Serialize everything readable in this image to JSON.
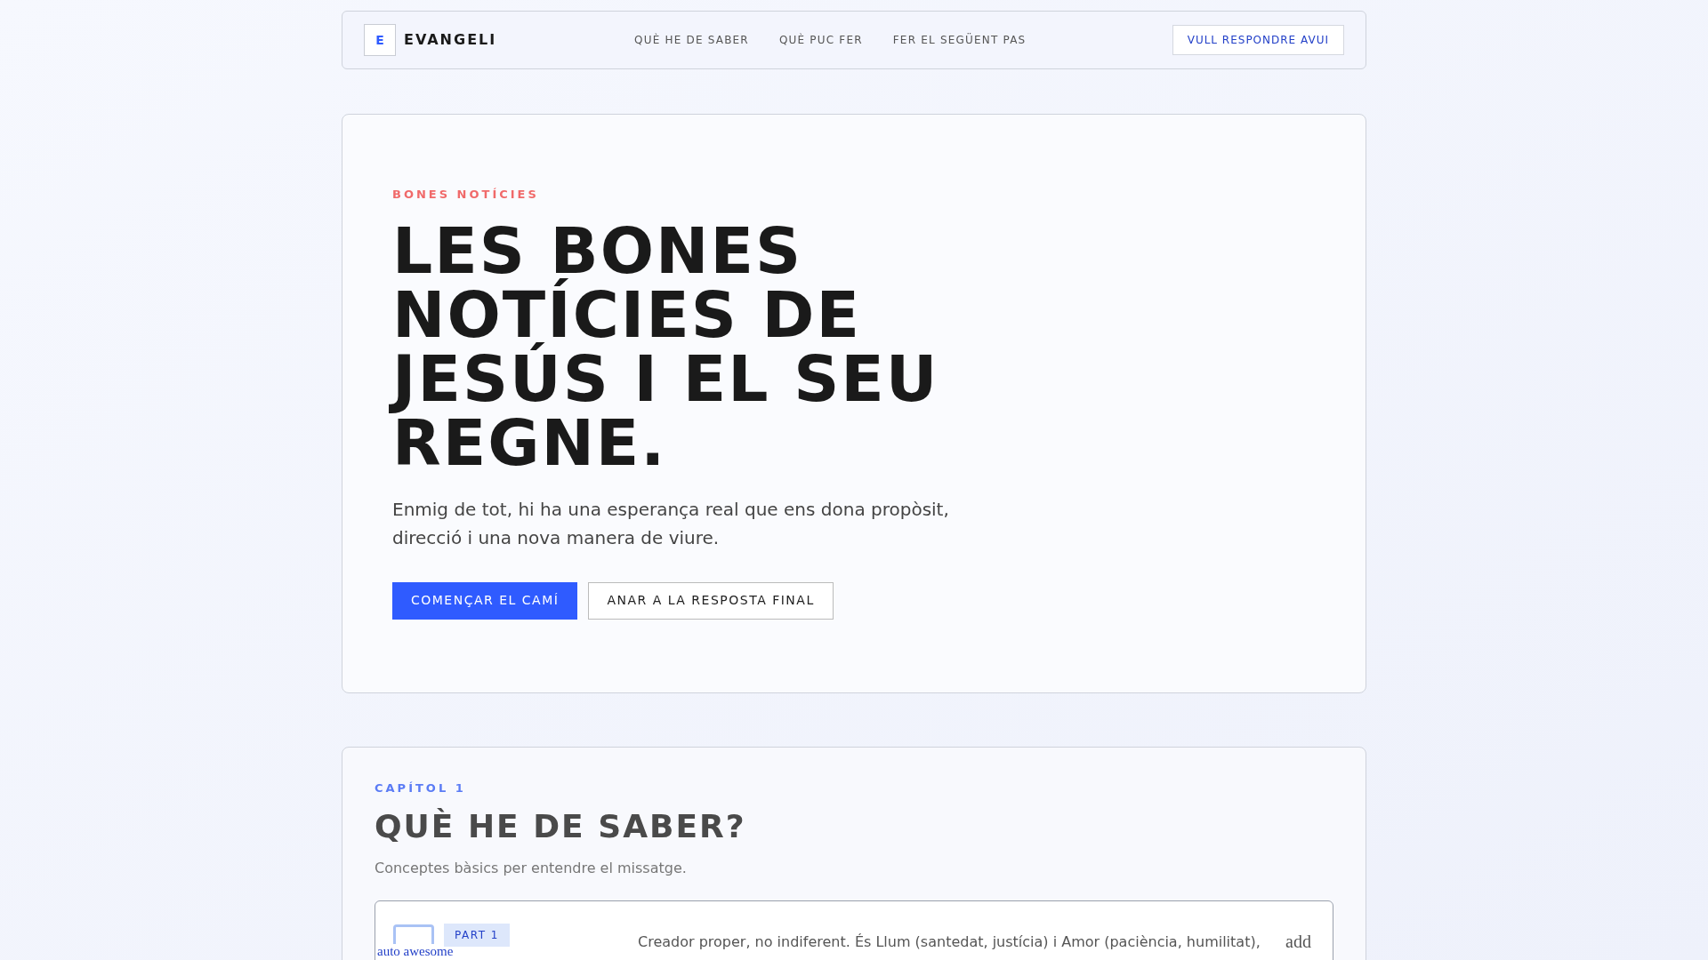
{
  "brand": {
    "logo_letter": "E",
    "name": "EVANGELI"
  },
  "nav": [
    "QUÈ HE DE SABER",
    "QUÈ PUC FER",
    "FER EL SEGÜENT PAS"
  ],
  "nav_cta": "VULL RESPONDRE AVUI",
  "hero": {
    "eyebrow": "BONES NOTÍCIES",
    "title": "LES BONES NOTÍCIES DE JESÚS I EL SEU REGNE.",
    "lead": "Enmig de tot, hi ha una esperança real que ens dona propòsit, direcció i una nova manera de viure.",
    "buttons": [
      {
        "label": "COMENÇAR EL CAMÍ",
        "kind": "primary"
      },
      {
        "label": "ANAR A LA RESPOSTA FINAL",
        "kind": "secondary"
      }
    ]
  },
  "chapter": {
    "eyebrow": "CAPÍTOL 1",
    "title": "QUÈ HE DE SABER?",
    "subtitle": "Conceptes bàsics per entendre el missatge.",
    "card": {
      "icon_text": "auto awesome",
      "badge": "PART 1",
      "text": "Creador proper, no indiferent. És Llum (santedat, justícia) i Amor (paciència, humilitat),",
      "toggle_text": "add"
    }
  }
}
